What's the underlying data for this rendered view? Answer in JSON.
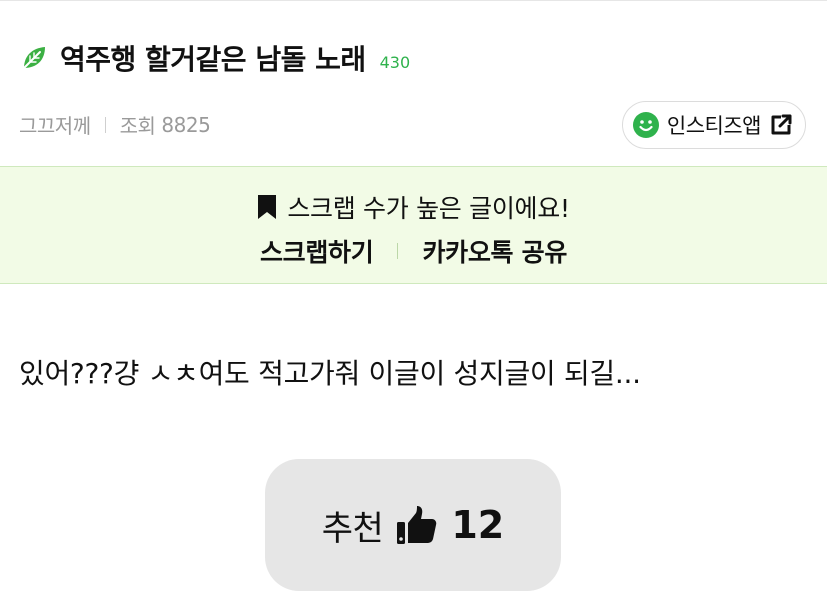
{
  "post": {
    "title": "역주행 할거같은 남돌 노래",
    "comment_count": "430",
    "date": "그끄저께",
    "views_label": "조회",
    "views": "8825",
    "body": "있어???걍 ㅅㅊ여도 적고가줘 이글이 성지글이 되길..."
  },
  "app_button": {
    "label": "인스티즈앱",
    "icon": "smile-icon",
    "accent": "#2fb24c"
  },
  "scrap_banner": {
    "message": "스크랩 수가 높은 글이에요!",
    "scrap_label": "스크랩하기",
    "share_label": "카카오톡 공유",
    "background": "#f2fbe6"
  },
  "recommend": {
    "label": "추천",
    "count": "12",
    "icon": "thumbs-up-icon"
  },
  "colors": {
    "accent_green": "#2fb24c",
    "leaf_green": "#3cb043"
  }
}
